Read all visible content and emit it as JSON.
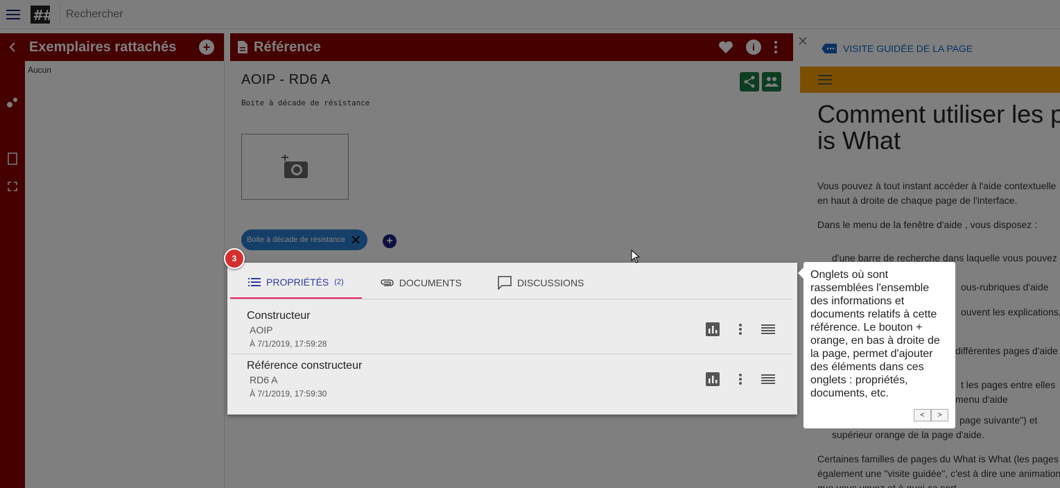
{
  "topbar": {
    "search_placeholder": "Rechercher"
  },
  "left_panel": {
    "title": "Exemplaires rattachés",
    "empty_text": "Aucun"
  },
  "mid_panel": {
    "title": "Référence",
    "ref_title": "AOIP - RD6 A",
    "ref_desc": "Boite à décade de résistance",
    "chip_label": "Boite à décade de résistance"
  },
  "right_panel": {
    "tour_label": "VISITE GUIDÉE DE LA PAGE",
    "help_title_1": "Comment utiliser les p",
    "help_title_2": "is What",
    "p1a": "Vous pouvez à tout instant accéder à l'aide contextuelle",
    "p1b": "en haut à droite de chaque page de l'interface.",
    "p2": "Dans le menu de la fenêtre d'aide , vous disposez :",
    "bullet1": "d'une barre de recherche dans laquelle vous pouvez",
    "frag1": "ous-rubriques d'aide",
    "frag2": "ouvent les explications,",
    "frag3": "différentes pages d'aide",
    "frag4": "t les pages entre elles",
    "frag5": "menu d'aide",
    "frag6": "page suivante\") et",
    "frag7": "supérieur orange de la page d'aide.",
    "p3a": "Certaines familles de pages du What is What (les pages",
    "p3b": "également une \"visite guidée\", c'est à dire une animation",
    "p3c": "que vous voyez et à quoi ça sert"
  },
  "card": {
    "tabs": [
      {
        "label": "PROPRIÉTÉS",
        "count": "(2)"
      },
      {
        "label": "DOCUMENTS"
      },
      {
        "label": "DISCUSSIONS"
      }
    ],
    "rows": [
      {
        "name": "Constructeur",
        "value": "AOIP",
        "date": "À 7/1/2019, 17:59:28"
      },
      {
        "name": "Référence constructeur",
        "value": "RD6 A",
        "date": "À 7/1/2019, 17:59:30"
      }
    ]
  },
  "tour": {
    "step": "3",
    "text": "Onglets où sont rassemblées l'ensemble des informations et documents relatifs à cette référence. Le bouton + orange, en bas à droite de la page, permet d'ajouter des éléments dans ces onglets : propriétés, documents, etc.",
    "prev": "<",
    "next": ">"
  },
  "colors": {
    "brand_red": "#8b0000",
    "accent_orange": "#f5a000",
    "active_tab": "#2f3a9e",
    "tab_underline": "#e91e63"
  }
}
